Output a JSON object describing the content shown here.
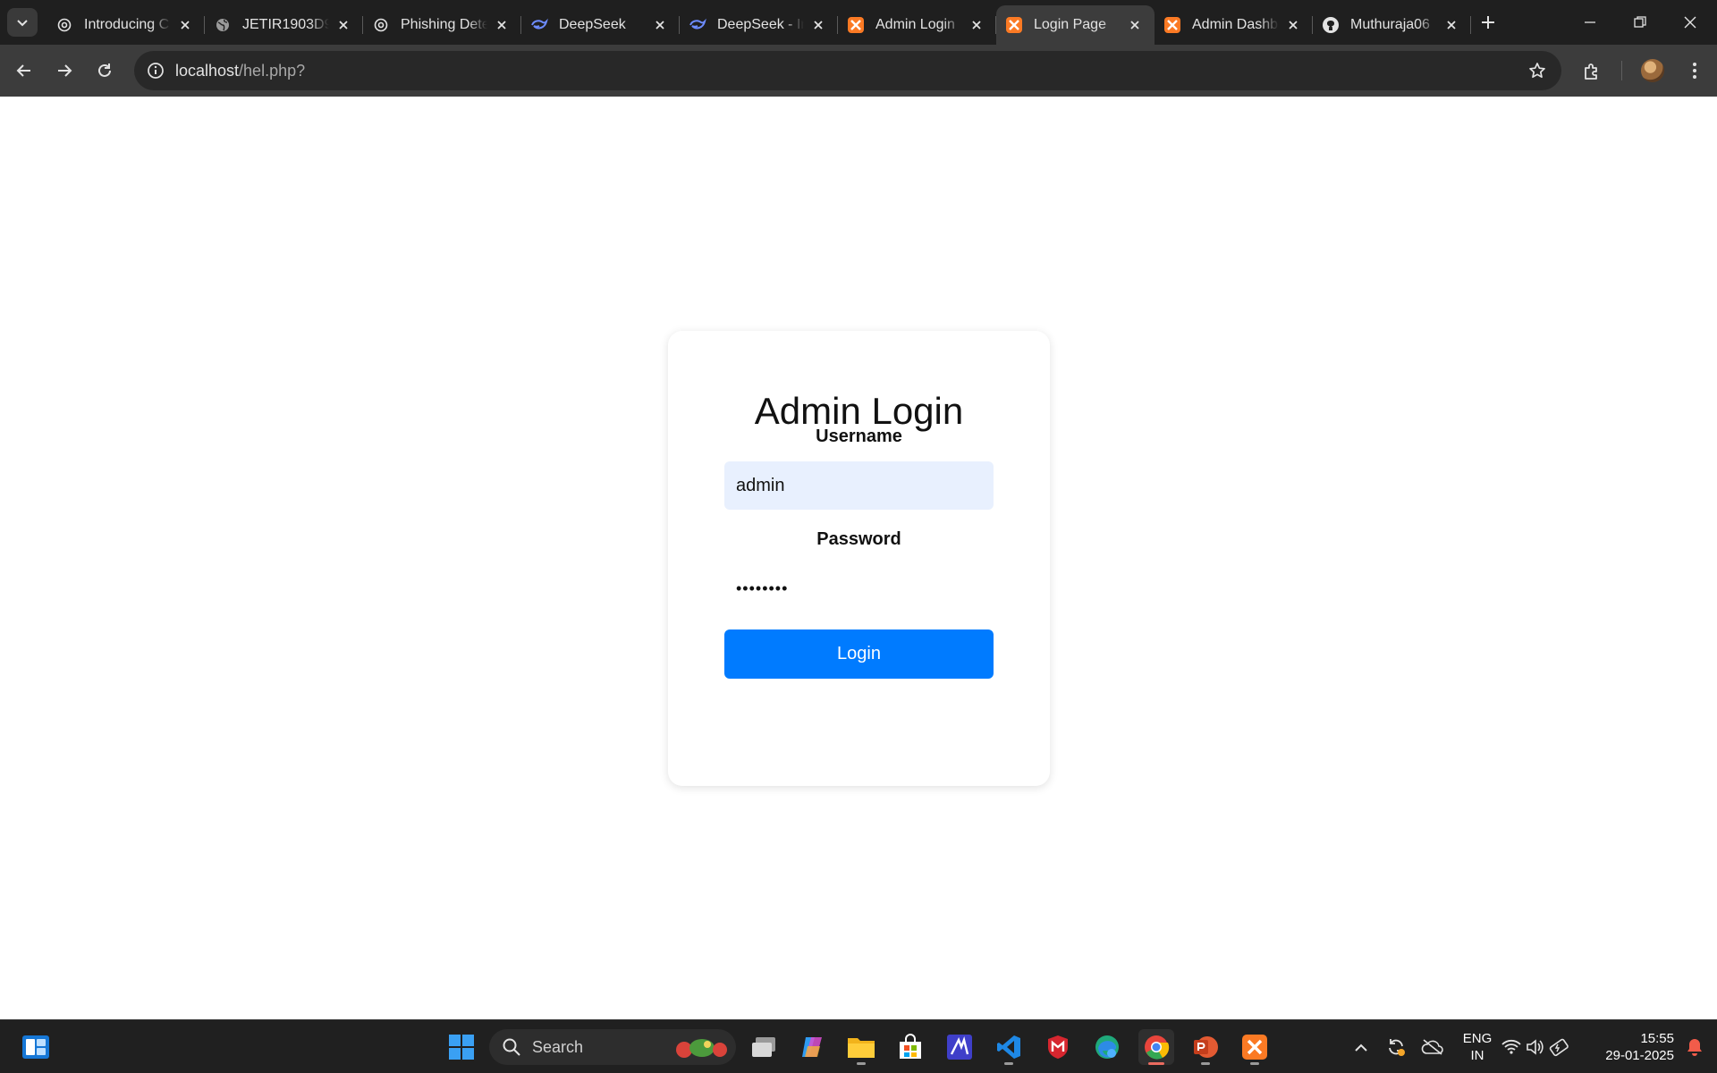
{
  "browser": {
    "tabs": [
      {
        "title": "Introducing C",
        "icon": "openai-icon",
        "active": false
      },
      {
        "title": "JETIR1903D90",
        "icon": "globe-icon",
        "active": false
      },
      {
        "title": "Phishing Dete",
        "icon": "openai-icon",
        "active": false
      },
      {
        "title": "DeepSeek",
        "icon": "deepseek-icon",
        "active": false
      },
      {
        "title": "DeepSeek - In",
        "icon": "deepseek-icon",
        "active": false
      },
      {
        "title": "Admin Login",
        "icon": "xampp-icon",
        "active": false
      },
      {
        "title": "Login Page",
        "icon": "xampp-icon",
        "active": true
      },
      {
        "title": "Admin Dashb",
        "icon": "xampp-icon",
        "active": false
      },
      {
        "title": "Muthuraja06",
        "icon": "github-icon",
        "active": false
      }
    ],
    "address": {
      "host": "localhost",
      "path": "/hel.php?"
    }
  },
  "page": {
    "title": "Admin Login",
    "username_label": "Username",
    "username_value": "admin",
    "password_label": "Password",
    "password_value": "••••••••",
    "login_button": "Login"
  },
  "taskbar": {
    "search_label": "Search",
    "language": "ENG",
    "region": "IN",
    "time": "15:55",
    "date": "29-01-2025"
  },
  "colors": {
    "tabstrip": "#1f1f1f",
    "toolbar": "#3c3c3c",
    "login_button": "#007bff",
    "username_field": "#e8f0fe",
    "taskbar": "#202020"
  }
}
